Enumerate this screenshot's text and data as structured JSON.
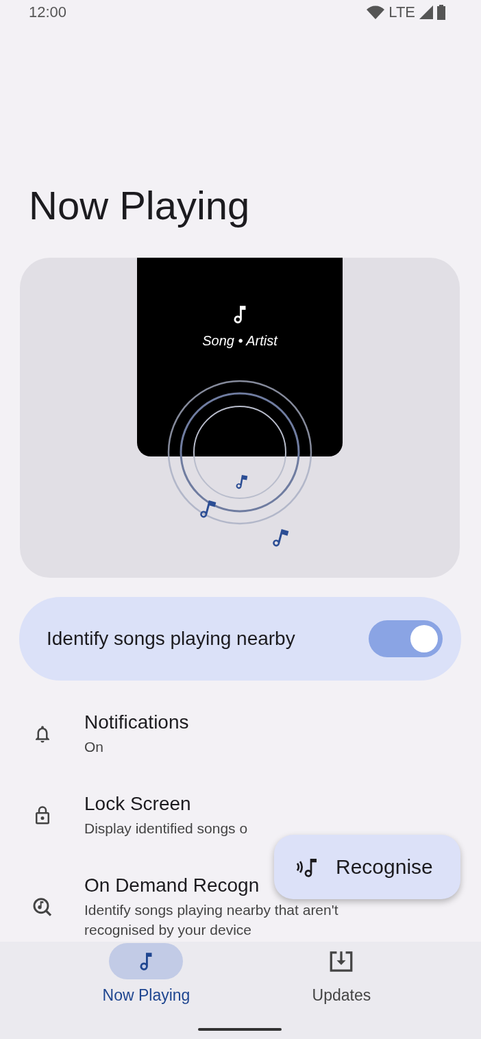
{
  "status_bar": {
    "time": "12:00",
    "network": "LTE"
  },
  "title": "Now Playing",
  "illustration": {
    "caption": "Song • Artist"
  },
  "identify_toggle": {
    "label": "Identify songs playing nearby",
    "on": true
  },
  "settings": [
    {
      "title": "Notifications",
      "subtitle": "On"
    },
    {
      "title": "Lock Screen",
      "subtitle": "Display identified songs o"
    },
    {
      "title": "On Demand Recogn",
      "subtitle": "Identify songs playing nearby that aren't recognised by your device"
    }
  ],
  "fab": {
    "label": "Recognise"
  },
  "nav": [
    {
      "label": "Now Playing",
      "selected": true
    },
    {
      "label": "Updates",
      "selected": false
    }
  ]
}
